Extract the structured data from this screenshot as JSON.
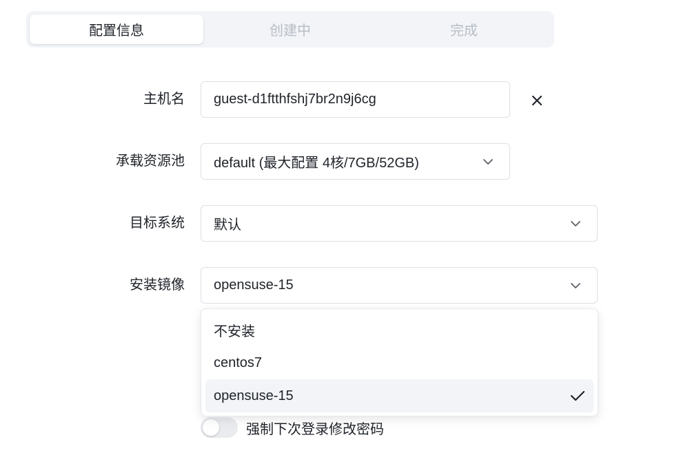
{
  "steps": [
    {
      "label": "配置信息",
      "active": true
    },
    {
      "label": "创建中",
      "active": false
    },
    {
      "label": "完成",
      "active": false
    }
  ],
  "form": {
    "hostname": {
      "label": "主机名",
      "value": "guest-d1ftthfshj7br2n9j6cg"
    },
    "pool": {
      "label": "承载资源池",
      "value": "default (最大配置 4核/7GB/52GB)"
    },
    "target_os": {
      "label": "目标系统",
      "value": "默认"
    },
    "image": {
      "label": "安装镜像",
      "value": "opensuse-15"
    }
  },
  "image_options": [
    {
      "label": "不安装",
      "selected": false
    },
    {
      "label": "centos7",
      "selected": false
    },
    {
      "label": "opensuse-15",
      "selected": true
    }
  ],
  "force_password_change": {
    "label": "强制下次登录修改密码",
    "enabled": false
  },
  "colors": {
    "accent_bg": "#f2f4f7",
    "border": "#dcdfe5",
    "muted_text": "#b9bec6"
  }
}
